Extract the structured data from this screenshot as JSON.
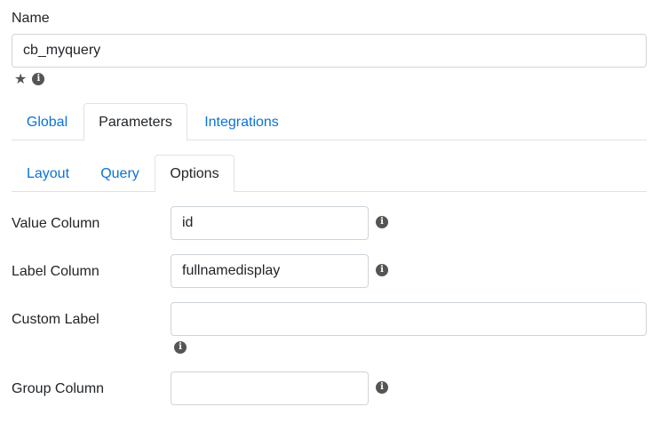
{
  "name": {
    "label": "Name",
    "value": "cb_myquery",
    "icons": [
      "star-icon",
      "info-icon"
    ]
  },
  "tabs_primary": [
    {
      "label": "Global",
      "active": false
    },
    {
      "label": "Parameters",
      "active": true
    },
    {
      "label": "Integrations",
      "active": false
    }
  ],
  "tabs_secondary": [
    {
      "label": "Layout",
      "active": false
    },
    {
      "label": "Query",
      "active": false
    },
    {
      "label": "Options",
      "active": true
    }
  ],
  "fields": {
    "value_column": {
      "label": "Value Column",
      "value": "id"
    },
    "label_column": {
      "label": "Label Column",
      "value": "fullnamedisplay"
    },
    "custom_label": {
      "label": "Custom Label",
      "value": ""
    },
    "group_column": {
      "label": "Group Column",
      "value": ""
    }
  },
  "colors": {
    "link": "#0b72d6",
    "border": "#dee2e6",
    "icon": "#555555"
  },
  "icon_glyphs": {
    "info": "i",
    "star": "★"
  }
}
